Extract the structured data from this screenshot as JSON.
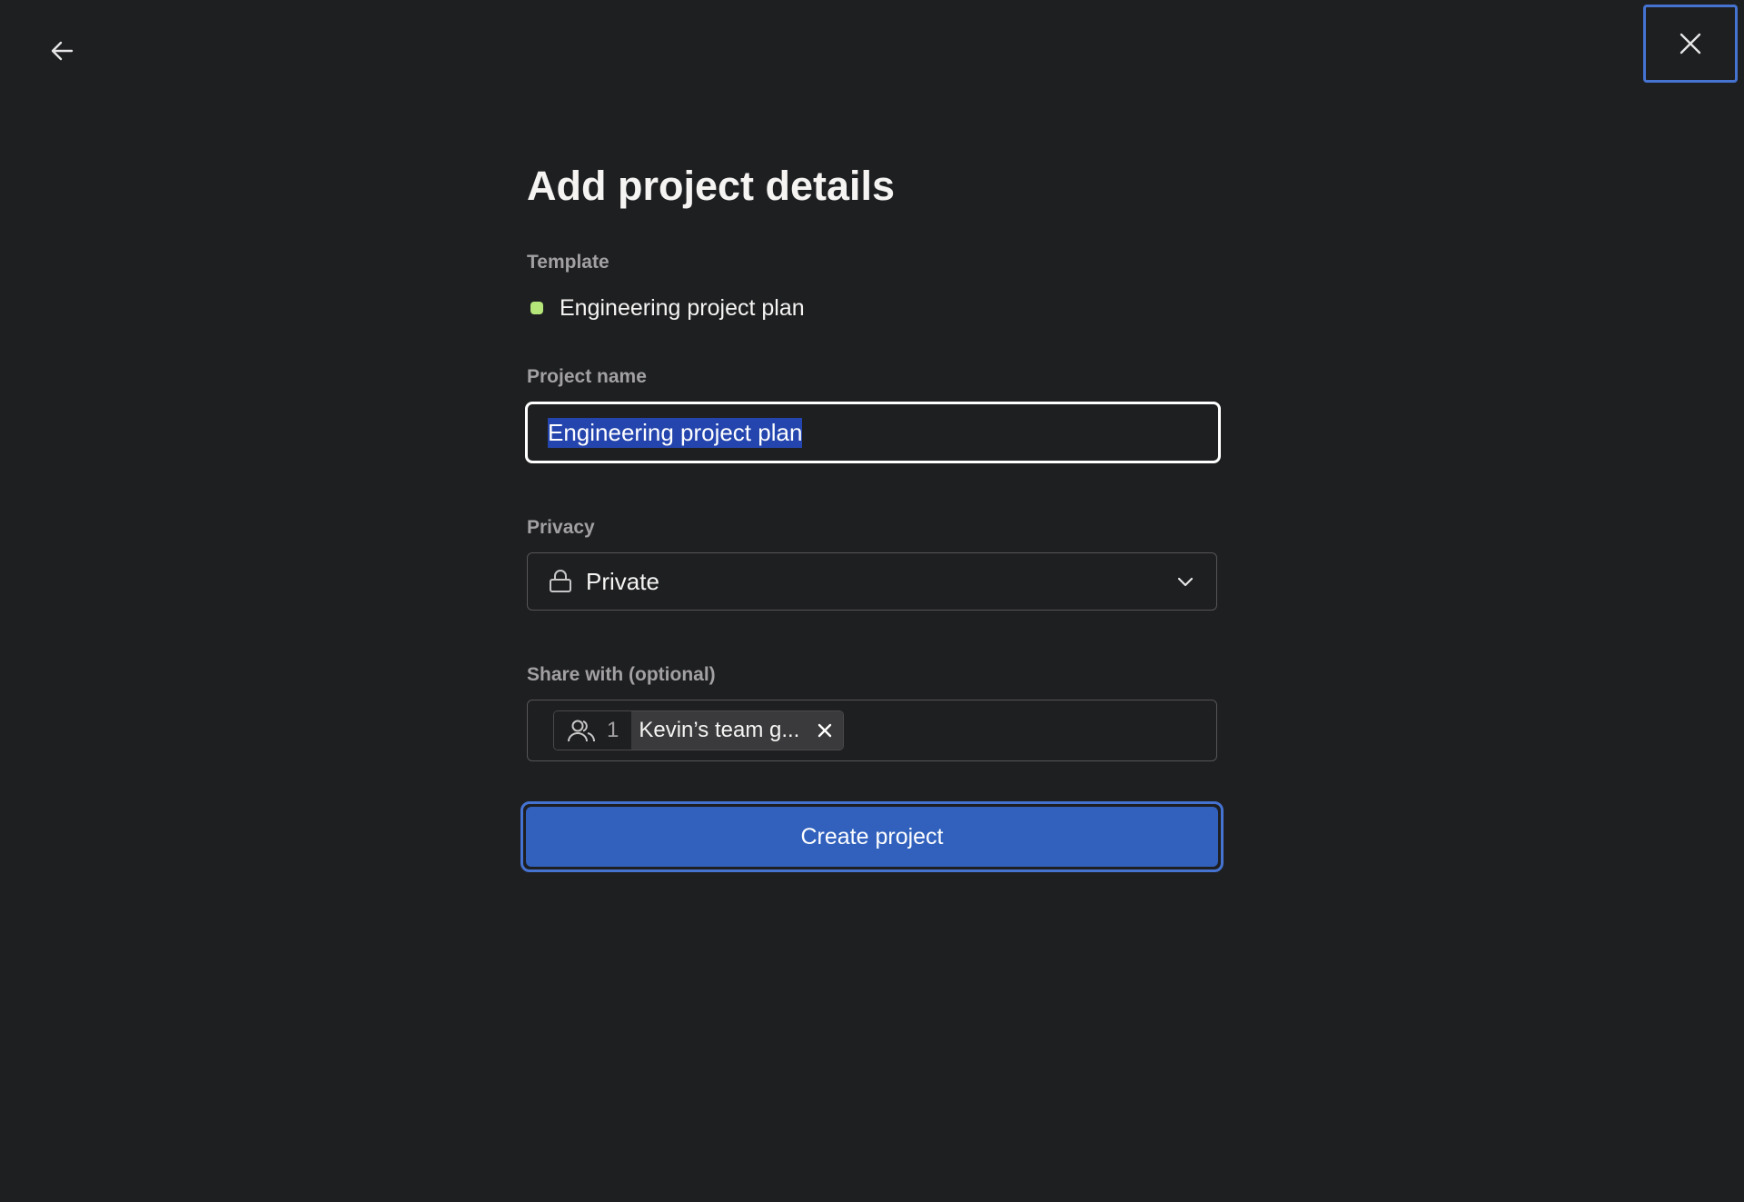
{
  "header": {
    "back_icon": "arrow-left-icon",
    "close_icon": "close-icon"
  },
  "main": {
    "title": "Add project details",
    "template": {
      "label": "Template",
      "name": "Engineering project plan",
      "color": "#b5e67a"
    },
    "project_name": {
      "label": "Project name",
      "value": "Engineering project plan"
    },
    "privacy": {
      "label": "Privacy",
      "value": "Private",
      "icon": "lock-icon"
    },
    "share_with": {
      "label": "Share with (optional)",
      "chip": {
        "icon": "team-icon",
        "count": "1",
        "label": "Kevin’s team g..."
      }
    },
    "create_button": {
      "label": "Create project"
    }
  },
  "colors": {
    "background": "#1e1f21",
    "accent": "#4573d2",
    "button": "#3161bd",
    "selection": "#2445ad"
  }
}
